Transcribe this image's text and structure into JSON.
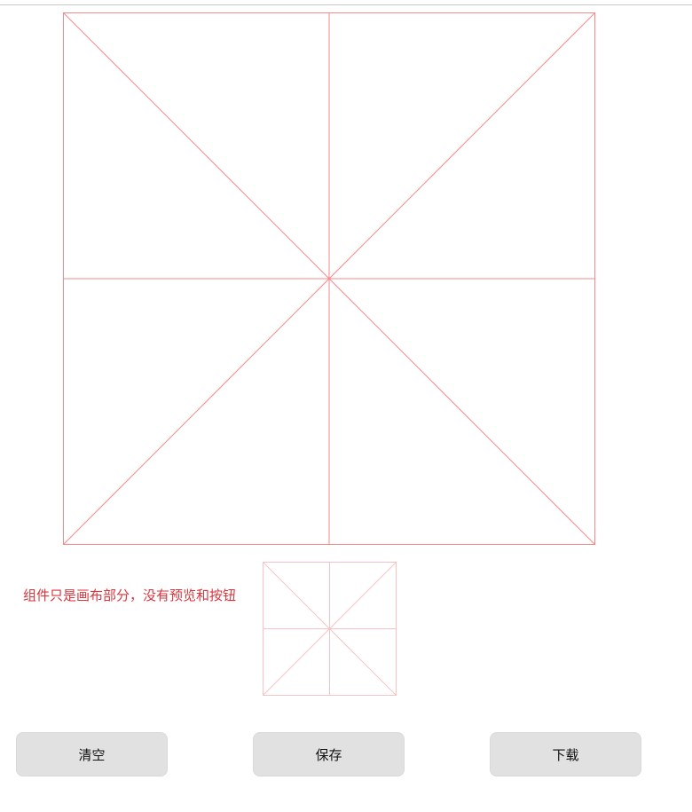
{
  "theme": {
    "grid_color": "#f28b8b",
    "preview_grid_color": "#f6c4c4",
    "note_color": "#d9363e",
    "button_bg": "#e1e1e1"
  },
  "note": {
    "text": "组件只是画布部分，没有预览和按钮"
  },
  "icons": {
    "writing_grid": "mi-zi-ge-grid",
    "preview_grid": "mi-zi-ge-grid-small"
  },
  "buttons": {
    "clear_label": "清空",
    "save_label": "保存",
    "download_label": "下载"
  }
}
